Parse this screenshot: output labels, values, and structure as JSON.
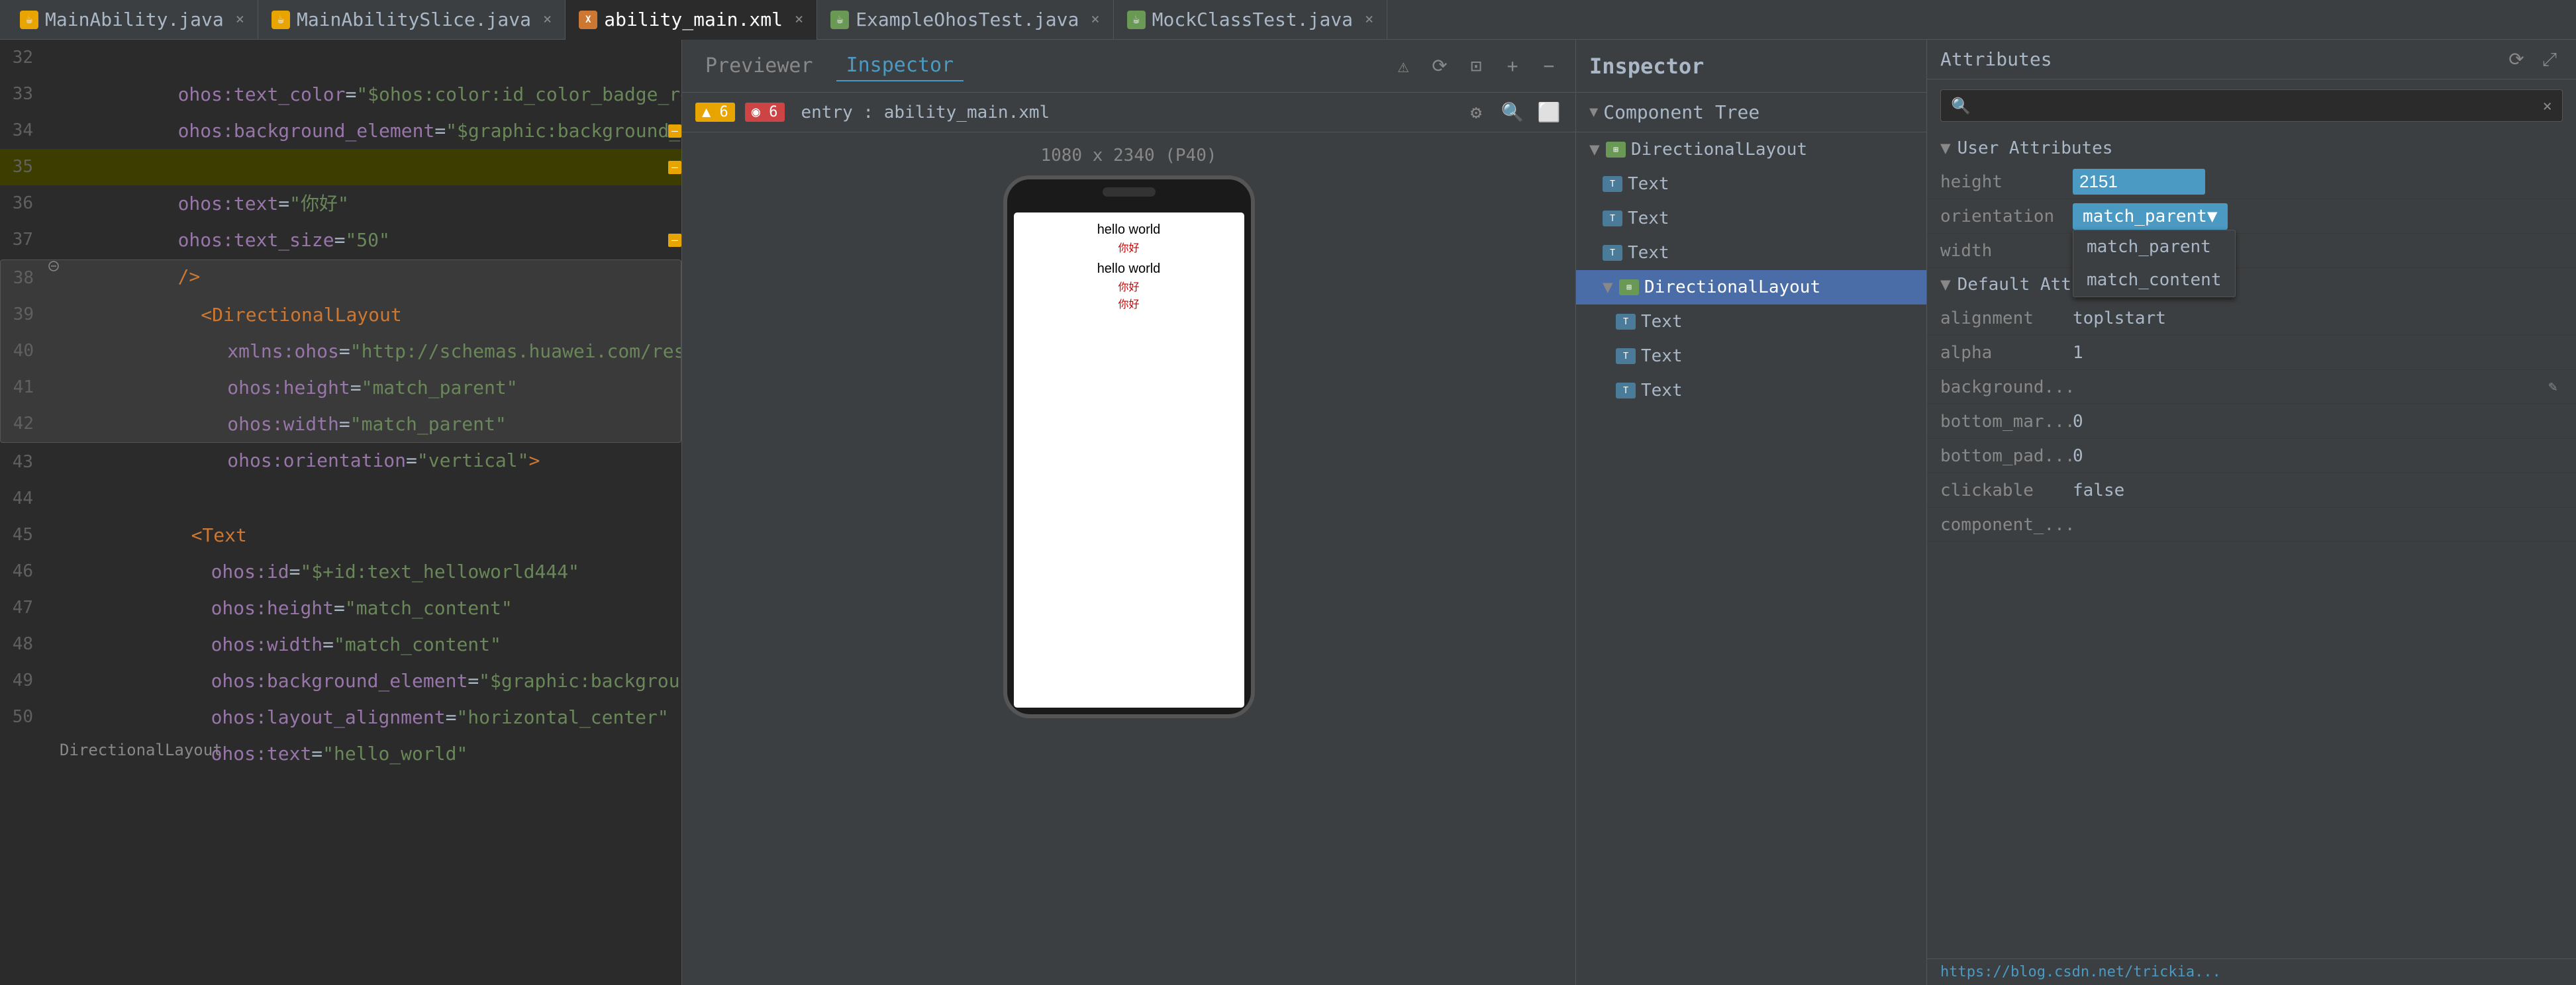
{
  "tabs": [
    {
      "id": "main-ability",
      "label": "MainAbility.java",
      "icon": "☕",
      "iconColor": "orange",
      "active": false
    },
    {
      "id": "main-ability-slice",
      "label": "MainAbilitySlice.java",
      "icon": "☕",
      "iconColor": "orange",
      "active": false
    },
    {
      "id": "ability-main-xml",
      "label": "ability_main.xml",
      "icon": "X",
      "iconColor": "xml",
      "active": true
    },
    {
      "id": "example-ohos",
      "label": "ExampleOhosTest.java",
      "icon": "☕",
      "iconColor": "green",
      "active": false
    },
    {
      "id": "mock-class",
      "label": "MockClassTest.java",
      "icon": "☕",
      "iconColor": "mock",
      "active": false
    }
  ],
  "code": {
    "lines": [
      {
        "num": 32,
        "indent": 1,
        "text": "ohos:text_color=\"$ohos:color:id_color_badge_red\"",
        "parts": [
          {
            "t": "attr",
            "v": "ohos:text_color"
          },
          {
            "t": "eq",
            "v": "="
          },
          {
            "t": "str",
            "v": "\"$ohos:color:id_color_badge_red\""
          }
        ]
      },
      {
        "num": 33,
        "indent": 1,
        "text": "ohos:background_element=\"$graphic:background_ability_main\"",
        "parts": [
          {
            "t": "attr"
          },
          {
            "t": "eq"
          },
          {
            "t": "str"
          }
        ]
      },
      {
        "num": 34,
        "indent": 1,
        "text": "ohos:layout_alignment=\"horizontal_center\"",
        "parts": []
      },
      {
        "num": 35,
        "indent": 1,
        "text": "ohos:text=\"你好\"",
        "highlight": true
      },
      {
        "num": 36,
        "indent": 1,
        "text": "ohos:text_size=\"50\""
      },
      {
        "num": 37,
        "indent": 1,
        "text": "/>"
      },
      {
        "num": 38,
        "indent": 0,
        "text": "<DirectionalLayout",
        "tag": true,
        "fold_start": true
      },
      {
        "num": 39,
        "indent": 2,
        "text": "xmlns:ohos=\"http://schemas.huawei.com/res/ohos\""
      },
      {
        "num": 40,
        "indent": 2,
        "text": "ohos:height=\"match_parent\""
      },
      {
        "num": 41,
        "indent": 2,
        "text": "ohos:width=\"match_parent\""
      },
      {
        "num": 42,
        "indent": 2,
        "text": "ohos:orientation=\"vertical\">"
      },
      {
        "num": 43,
        "indent": 0,
        "text": ""
      },
      {
        "num": 44,
        "indent": 2,
        "text": "<Text",
        "tag": true
      },
      {
        "num": 45,
        "indent": 3,
        "text": "ohos:id=\"$+id:text_helloworld444\""
      },
      {
        "num": 46,
        "indent": 3,
        "text": "ohos:height=\"match_content\""
      },
      {
        "num": 47,
        "indent": 3,
        "text": "ohos:width=\"match_content\""
      },
      {
        "num": 48,
        "indent": 3,
        "text": "ohos:background_element=\"$graphic:background_ability_main\""
      },
      {
        "num": 49,
        "indent": 3,
        "text": "ohos:layout_alignment=\"horizontal_center\""
      },
      {
        "num": 50,
        "indent": 3,
        "text": "ohos:text=\"hello_world\"",
        "partial": true
      }
    ]
  },
  "previewer": {
    "tab_previewer": "Previewer",
    "tab_inspector": "Inspector",
    "active_tab": "Inspector",
    "entry_label": "entry : ability_main.xml",
    "warning_count": "▲ 6",
    "error_count": "◉ 6",
    "device_size": "1080 x 2340 (P40)",
    "screen_content": [
      {
        "text": "hello world",
        "color": "#000000",
        "size": 22,
        "align": "center"
      },
      {
        "text": "你好",
        "color": "#cc0000",
        "size": 18,
        "align": "center"
      },
      {
        "text": "hello world",
        "color": "#000000",
        "size": 22,
        "align": "center"
      },
      {
        "text": "你好",
        "color": "#cc0000",
        "size": 18,
        "align": "center"
      },
      {
        "text": "你好",
        "color": "#cc0000",
        "size": 18,
        "align": "center"
      }
    ]
  },
  "inspector": {
    "title": "Inspector",
    "component_tree_title": "Component Tree",
    "tree_items": [
      {
        "id": "directional-root",
        "label": "DirectionalLayout",
        "type": "layout",
        "depth": 0,
        "expanded": true
      },
      {
        "id": "text-1",
        "label": "Text",
        "type": "text",
        "depth": 1
      },
      {
        "id": "text-2",
        "label": "Text",
        "type": "text",
        "depth": 1
      },
      {
        "id": "text-3",
        "label": "Text",
        "type": "text",
        "depth": 1
      },
      {
        "id": "directional-inner",
        "label": "DirectionalLayout",
        "type": "layout",
        "depth": 1,
        "selected": true,
        "expanded": true
      },
      {
        "id": "text-4",
        "label": "Text",
        "type": "text",
        "depth": 2
      },
      {
        "id": "text-5",
        "label": "Text",
        "type": "text",
        "depth": 2
      },
      {
        "id": "text-6",
        "label": "Text",
        "type": "text",
        "depth": 2
      }
    ]
  },
  "attributes": {
    "title": "Attributes",
    "search_placeholder": "",
    "sections": [
      {
        "id": "user-attrs",
        "title": "User Attributes",
        "rows": [
          {
            "name": "height",
            "value": "2151",
            "editable": true,
            "input": true
          },
          {
            "name": "orientation",
            "value": "match_parent",
            "dropdown": true,
            "dropdown_options": [
              "match_parent",
              "match_content"
            ]
          },
          {
            "name": "width",
            "value": "",
            "editable": true
          }
        ]
      },
      {
        "id": "default-attrs",
        "title": "Default Attributes",
        "rows": [
          {
            "name": "alignment",
            "value": "toplstart"
          },
          {
            "name": "alpha",
            "value": "1"
          },
          {
            "name": "background...",
            "value": "",
            "has_icon": true
          },
          {
            "name": "bottom_mar...",
            "value": "0"
          },
          {
            "name": "bottom_pad...",
            "value": "0"
          },
          {
            "name": "clickable",
            "value": "false"
          },
          {
            "name": "component_...",
            "value": ""
          }
        ]
      }
    ]
  },
  "bottom": {
    "link_text": "https://blog.csdn.net/trickia..."
  }
}
